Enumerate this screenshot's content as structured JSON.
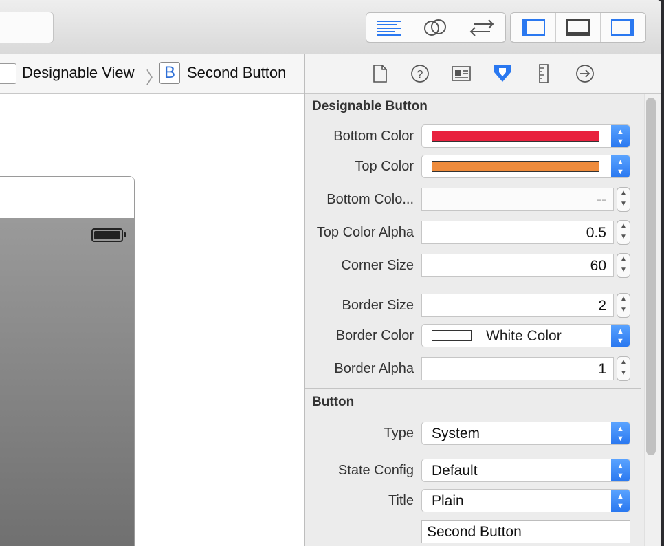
{
  "toolbar": {
    "editor_icons": [
      "standard-editor-icon",
      "assistant-editor-icon",
      "version-editor-icon"
    ],
    "view_icons": [
      "navigator-toggle-icon",
      "debug-area-toggle-icon",
      "utilities-toggle-icon"
    ]
  },
  "jumpbar": {
    "view_label": "Designable View",
    "button_badge": "B",
    "button_label": "Second Button"
  },
  "inspector_tabs": [
    "file-inspector-icon",
    "quick-help-icon",
    "identity-inspector-icon",
    "attributes-inspector-icon",
    "size-inspector-icon",
    "connections-inspector-icon"
  ],
  "designable_button": {
    "title": "Designable Button",
    "bottom_color_label": "Bottom Color",
    "bottom_color_value": "#e8213e",
    "top_color_label": "Top Color",
    "top_color_value": "#ee8b3c",
    "bottom_alpha_label": "Bottom Colo...",
    "bottom_alpha_placeholder": "--",
    "top_alpha_label": "Top Color Alpha",
    "top_alpha_value": "0.5",
    "corner_size_label": "Corner Size",
    "corner_size_value": "60",
    "border_size_label": "Border Size",
    "border_size_value": "2",
    "border_color_label": "Border Color",
    "border_color_name": "White Color",
    "border_alpha_label": "Border Alpha",
    "border_alpha_value": "1"
  },
  "button": {
    "title": "Button",
    "type_label": "Type",
    "type_value": "System",
    "state_config_label": "State Config",
    "state_config_value": "Default",
    "title_label": "Title",
    "title_value": "Plain",
    "title_text_value": "Second Button"
  }
}
